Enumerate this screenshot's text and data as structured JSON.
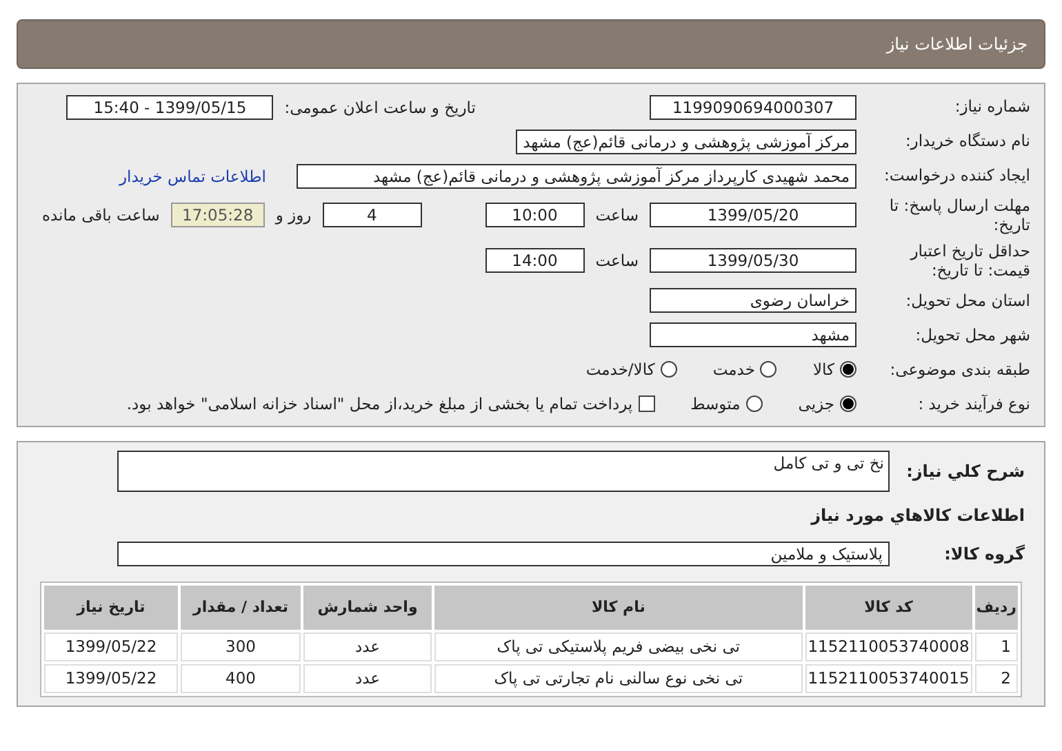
{
  "header": {
    "title": "جزئیات اطلاعات نیاز"
  },
  "need_number": {
    "label": "شماره نیاز:",
    "value": "1199090694000307"
  },
  "announce": {
    "label": "تاریخ و ساعت اعلان عمومی:",
    "value": "1399/05/15 - 15:40"
  },
  "buyer_org": {
    "label": "نام دستگاه خریدار:",
    "value": "مرکز آموزشی پژوهشی و درمانی قائم(عج) مشهد"
  },
  "requester": {
    "label": "ایجاد کننده درخواست:",
    "value": "محمد شهیدی کارپرداز مرکز آموزشی پژوهشی و درمانی قائم(عج) مشهد",
    "link": "اطلاعات تماس خریدار"
  },
  "reply_deadline": {
    "label": "مهلت ارسال پاسخ: تا تاریخ:",
    "date": "1399/05/20",
    "time_label": "ساعت",
    "time": "10:00",
    "days": "4",
    "days_label": "روز و",
    "remaining": "17:05:28",
    "remaining_label": "ساعت باقی مانده"
  },
  "price_validity": {
    "label": "حداقل تاریخ اعتبار قیمت: تا تاریخ:",
    "date": "1399/05/30",
    "time_label": "ساعت",
    "time": "14:00"
  },
  "province": {
    "label": "استان محل تحویل:",
    "value": "خراسان رضوی"
  },
  "city": {
    "label": "شهر محل تحویل:",
    "value": "مشهد"
  },
  "category": {
    "label": "طبقه بندی موضوعی:",
    "options": [
      {
        "label": "کالا",
        "selected": true
      },
      {
        "label": "خدمت",
        "selected": false
      },
      {
        "label": "کالا/خدمت",
        "selected": false
      }
    ]
  },
  "purchase_type": {
    "label": "نوع فرآیند خرید :",
    "options": [
      {
        "label": "جزیی",
        "selected": true
      },
      {
        "label": "متوسط",
        "selected": false
      }
    ],
    "treasury": {
      "checked": false,
      "text": "پرداخت تمام یا بخشی از مبلغ خرید،از محل \"اسناد خزانه اسلامی\" خواهد بود."
    }
  },
  "description": {
    "label": "شرح کلي نیاز:",
    "value": "نخ تی و تی کامل"
  },
  "goods_title": "اطلاعات کالاهاي مورد نیاز",
  "goods_group": {
    "label": "گروه کالا:",
    "value": "پلاستیک و ملامین"
  },
  "table": {
    "columns": [
      "ردیف",
      "کد کالا",
      "نام کالا",
      "واحد شمارش",
      "تعداد / مقدار",
      "تاریخ نیاز"
    ],
    "rows": [
      [
        "1",
        "1152110053740008",
        "تی نخی بیضی فریم پلاستیکی تی پاک",
        "عدد",
        "300",
        "1399/05/22"
      ],
      [
        "2",
        "1152110053740015",
        "تی نخی نوع سالنی نام تجارتی تی پاک",
        "عدد",
        "400",
        "1399/05/22"
      ]
    ]
  }
}
